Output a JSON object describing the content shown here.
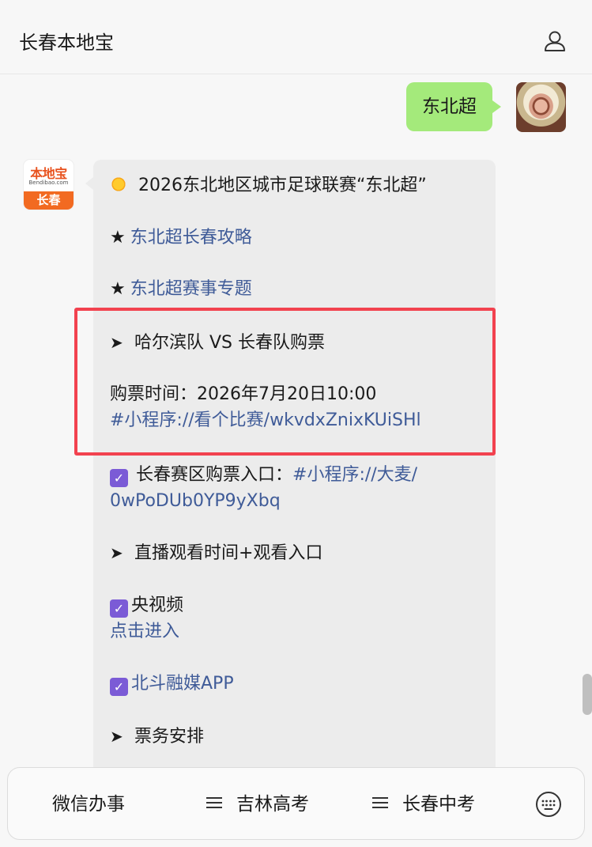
{
  "header": {
    "title": "长春本地宝",
    "profile_icon": "person-outline-icon"
  },
  "user_message": {
    "text": "东北超"
  },
  "bot": {
    "avatar": {
      "logo_text": "本地宝",
      "logo_subtext": "Bendibao.com",
      "city": "长春"
    },
    "lines": {
      "title": "2026东北地区城市足球联赛“东北超”",
      "guide_star": "★",
      "guide_link": "东北超长春攻略",
      "topic_star": "★",
      "topic_link": "东北超赛事专题",
      "match_arrow": "➤",
      "match_title": "哈尔滨队 VS 长春队购票",
      "ticket_time": "购票时间：2026年7月20日10:00",
      "ticket_link": "#小程序://看个比赛/wkvdxZnixKUiSHl",
      "entry_check": "✓",
      "entry_label": "长春赛区购票入口：",
      "entry_link_1": "#小程序://大麦/",
      "entry_link_2": "0wPoDUb0YP9yXbq",
      "live_arrow": "➤",
      "live_title": "直播观看时间+观看入口",
      "cctv_check": "✓",
      "cctv_label": "央视频",
      "cctv_link": "点击进入",
      "beidou_check": "✓",
      "beidou_link": "北斗融媒APP",
      "ticket_arrow": "➤",
      "ticket_arrange": "票务安排"
    }
  },
  "bottom_menu": {
    "items": [
      {
        "label": "微信办事"
      },
      {
        "label": "吉林高考"
      },
      {
        "label": "长春中考"
      }
    ],
    "keyboard_icon": "keyboard-icon"
  },
  "colors": {
    "link": "#3f5b98",
    "user_bubble": "#a4ea7b",
    "highlight": "#f2424f",
    "checkbox": "#7b5bd6"
  }
}
